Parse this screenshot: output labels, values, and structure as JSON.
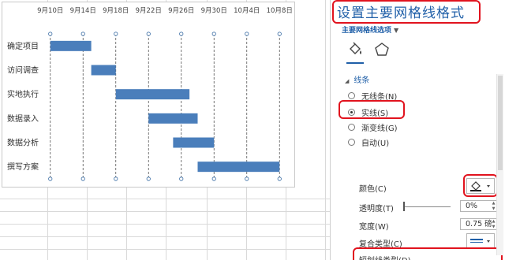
{
  "chart_data": {
    "type": "bar",
    "orientation": "horizontal",
    "x_ticks": [
      "9月10日",
      "9月14日",
      "9月18日",
      "9月22日",
      "9月26日",
      "9月30日",
      "10月4日",
      "10月8日"
    ],
    "categories": [
      "确定项目",
      "访问调查",
      "实地执行",
      "数据录入",
      "数据分析",
      "撰写方案"
    ],
    "tasks": [
      {
        "name": "确定项目",
        "start": "9月10日",
        "days": 5
      },
      {
        "name": "访问调查",
        "start": "9月15日",
        "days": 3
      },
      {
        "name": "实地执行",
        "start": "9月18日",
        "days": 9
      },
      {
        "name": "数据录入",
        "start": "9月22日",
        "days": 6
      },
      {
        "name": "数据分析",
        "start": "9月25日",
        "days": 5
      },
      {
        "name": "撰写方案",
        "start": "9月28日",
        "days": 10
      }
    ],
    "xlim": [
      "9月8日",
      "10月10日"
    ],
    "gridlines": "vertical dashed (major)",
    "bar_color": "#4a7ebb",
    "selected_element": "major gridlines"
  },
  "panel": {
    "title": "设置主要网格线格式",
    "options_dropdown": "主要网格线选项",
    "tabs": [
      {
        "icon": "paint-bucket-icon"
      },
      {
        "icon": "pentagon-icon"
      }
    ],
    "section_title": "线条",
    "line_options": [
      {
        "label": "无线条(N)",
        "selected": false
      },
      {
        "label": "实线(S)",
        "selected": true
      },
      {
        "label": "渐变线(G)",
        "selected": false
      },
      {
        "label": "自动(U)",
        "selected": false
      }
    ],
    "color_label": "颜色(C)",
    "transparency_label": "透明度(T)",
    "transparency_value": "0%",
    "width_label": "宽度(W)",
    "width_value": "0.75 磅",
    "compound_label": "复合类型(C)",
    "dash_label": "短划线类型(D)",
    "accent_color": "#1f5fa8",
    "highlight_color": "#e1131e"
  }
}
